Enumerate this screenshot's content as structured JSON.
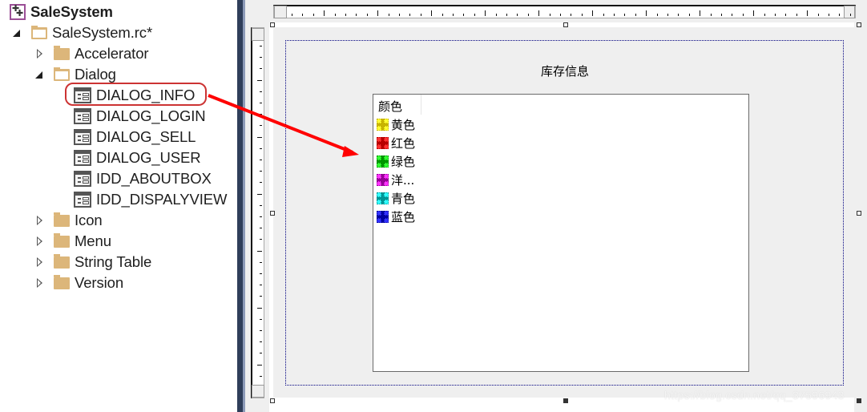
{
  "tree": {
    "root": {
      "label": "SaleSystem",
      "icon": "project-icon"
    },
    "rc_file": {
      "label": "SaleSystem.rc*",
      "expanded": true
    },
    "folders_before": [
      {
        "label": "Accelerator",
        "expanded": false
      }
    ],
    "dialog_folder": {
      "label": "Dialog",
      "expanded": true
    },
    "dialogs": [
      {
        "label": "DIALOG_INFO",
        "selected": true
      },
      {
        "label": "DIALOG_LOGIN"
      },
      {
        "label": "DIALOG_SELL"
      },
      {
        "label": "DIALOG_USER"
      },
      {
        "label": "IDD_ABOUTBOX"
      },
      {
        "label": "IDD_DISPALYVIEW"
      }
    ],
    "folders_after": [
      {
        "label": "Icon",
        "expanded": false
      },
      {
        "label": "Menu",
        "expanded": false
      },
      {
        "label": "String Table",
        "expanded": false
      },
      {
        "label": "Version",
        "expanded": false
      }
    ]
  },
  "annotation": {
    "highlight_color": "#cc3333",
    "arrow_color": "#ff0000"
  },
  "dialog_editor": {
    "static_text": "库存信息",
    "list_control": {
      "column_header": "颜色",
      "items": [
        {
          "label": "黄色",
          "color": "#c8b400",
          "light": "#ffff33"
        },
        {
          "label": "红色",
          "color": "#b80000",
          "light": "#ff3333"
        },
        {
          "label": "绿色",
          "color": "#009600",
          "light": "#33ff33"
        },
        {
          "label": "洋...",
          "color": "#960096",
          "light": "#ff33ff"
        },
        {
          "label": "青色",
          "color": "#009696",
          "light": "#33ffff"
        },
        {
          "label": "蓝色",
          "color": "#0000a0",
          "light": "#3333ff"
        }
      ]
    }
  },
  "watermark": "https://blog.csdn.net/qq_37596943"
}
